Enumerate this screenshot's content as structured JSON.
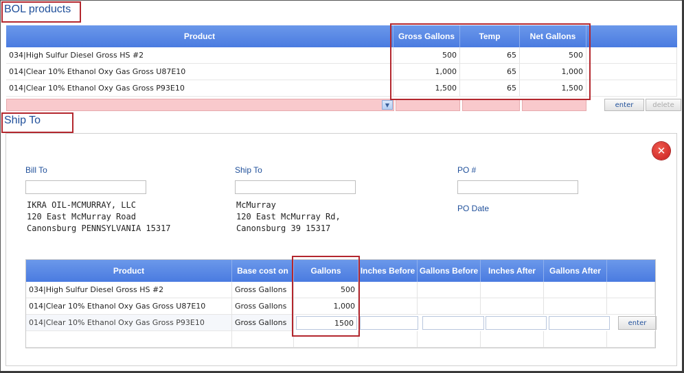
{
  "bol": {
    "title": "BOL products",
    "columns": [
      "Product",
      "Gross Gallons",
      "Temp",
      "Net Gallons"
    ],
    "rows": [
      {
        "product": "034|High Sulfur Diesel Gross HS #2",
        "gross": "500",
        "temp": "65",
        "net": "500"
      },
      {
        "product": "014|Clear 10% Ethanol Oxy Gas Gross U87E10",
        "gross": "1,000",
        "temp": "65",
        "net": "1,000"
      },
      {
        "product": "014|Clear 10% Ethanol Oxy Gas Gross P93E10",
        "gross": "1,500",
        "temp": "65",
        "net": "1,500"
      }
    ],
    "enter_label": "enter",
    "delete_label": "delete"
  },
  "shipto_section": {
    "title": "Ship To",
    "bill_to_label": "Bill To",
    "bill_to_lines": [
      "IKRA OIL-MCMURRAY, LLC",
      "120 East McMurray Road",
      "Canonsburg PENNSYLVANIA 15317"
    ],
    "ship_to_label": "Ship To",
    "ship_to_lines": [
      "McMurray",
      "120 East McMurray Rd,",
      "Canonsburg 39 15317"
    ],
    "po_label": "PO #",
    "po_date_label": "PO Date",
    "close_glyph": "✕"
  },
  "ship_table": {
    "columns": [
      "Product",
      "Base cost on",
      "Gallons",
      "Inches Before",
      "Gallons Before",
      "Inches After",
      "Gallons After"
    ],
    "rows": [
      {
        "product": "034|High Sulfur Diesel Gross HS #2",
        "base": "Gross Gallons",
        "gallons": "500"
      },
      {
        "product": "014|Clear 10% Ethanol Oxy Gas Gross U87E10",
        "base": "Gross Gallons",
        "gallons": "1,000"
      },
      {
        "product": "014|Clear 10% Ethanol Oxy Gas Gross P93E10",
        "base": "Gross Gallons",
        "gallons": "1500"
      }
    ],
    "enter_label": "enter"
  },
  "colors": {
    "header_blue": "#5585e6",
    "title_blue": "#1f4f9a",
    "highlight_red": "#b3262d",
    "error_pink": "#f9c9cc"
  },
  "icons": {
    "close": "close-circle-icon",
    "dropdown": "chevron-down-icon"
  }
}
